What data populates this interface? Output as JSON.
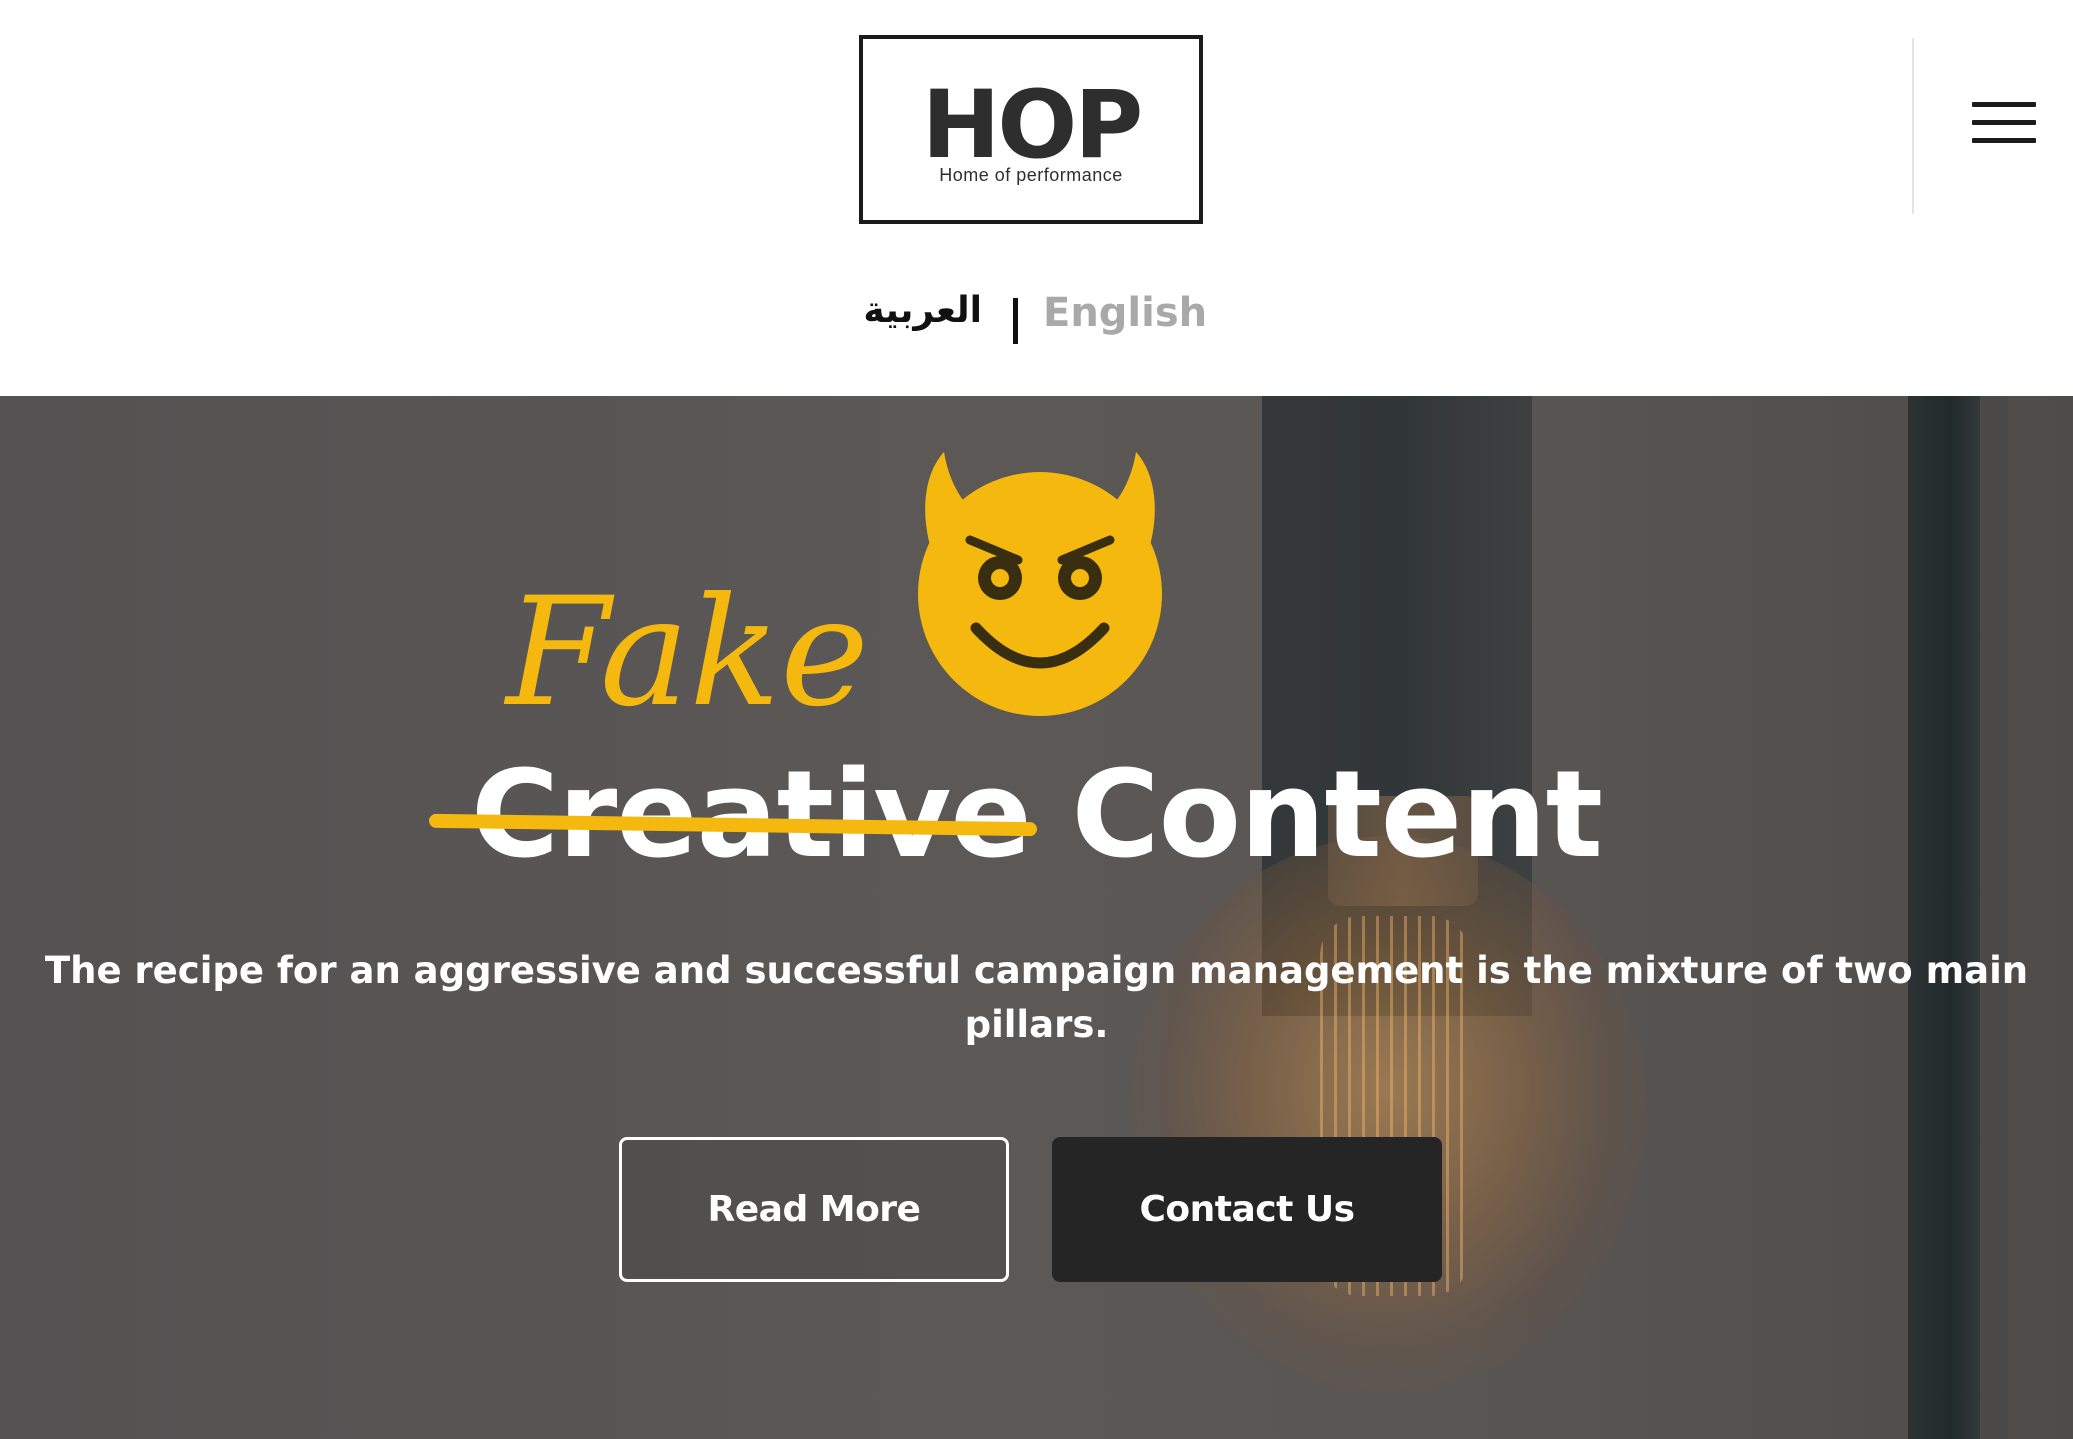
{
  "header": {
    "logo": {
      "word": "HOP",
      "tagline": "Home of performance"
    },
    "language": {
      "arabic_label": "العربية",
      "english_label": "English",
      "active": "English"
    },
    "menu_icon": "hamburger-menu-icon"
  },
  "hero": {
    "overlay_text": "Fake",
    "emoji": "smiling-devil-face-icon",
    "headline_struck": "Creative",
    "headline_rest": "Content",
    "subtitle": "The recipe for an aggressive and successful campaign management  is the mixture of two main pillars.",
    "buttons": {
      "read_more": "Read More",
      "contact_us": "Contact Us"
    }
  },
  "colors": {
    "accent_yellow": "#f4b80e",
    "hero_bg": "#575452",
    "button_dark": "#252525",
    "inactive_lang": "#a9a9a9"
  }
}
